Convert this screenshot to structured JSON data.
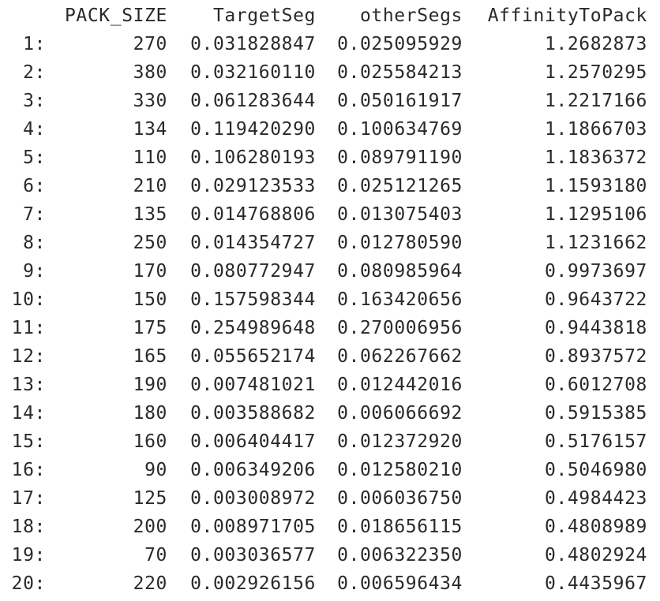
{
  "table": {
    "headers": {
      "index": "",
      "pack_size": "PACK_SIZE",
      "target_seg": "TargetSeg",
      "other_segs": "otherSegs",
      "affinity": "AffinityToPack"
    },
    "rows": [
      {
        "index": "1:",
        "pack_size": "270",
        "target_seg": "0.031828847",
        "other_segs": "0.025095929",
        "affinity": "1.2682873"
      },
      {
        "index": "2:",
        "pack_size": "380",
        "target_seg": "0.032160110",
        "other_segs": "0.025584213",
        "affinity": "1.2570295"
      },
      {
        "index": "3:",
        "pack_size": "330",
        "target_seg": "0.061283644",
        "other_segs": "0.050161917",
        "affinity": "1.2217166"
      },
      {
        "index": "4:",
        "pack_size": "134",
        "target_seg": "0.119420290",
        "other_segs": "0.100634769",
        "affinity": "1.1866703"
      },
      {
        "index": "5:",
        "pack_size": "110",
        "target_seg": "0.106280193",
        "other_segs": "0.089791190",
        "affinity": "1.1836372"
      },
      {
        "index": "6:",
        "pack_size": "210",
        "target_seg": "0.029123533",
        "other_segs": "0.025121265",
        "affinity": "1.1593180"
      },
      {
        "index": "7:",
        "pack_size": "135",
        "target_seg": "0.014768806",
        "other_segs": "0.013075403",
        "affinity": "1.1295106"
      },
      {
        "index": "8:",
        "pack_size": "250",
        "target_seg": "0.014354727",
        "other_segs": "0.012780590",
        "affinity": "1.1231662"
      },
      {
        "index": "9:",
        "pack_size": "170",
        "target_seg": "0.080772947",
        "other_segs": "0.080985964",
        "affinity": "0.9973697"
      },
      {
        "index": "10:",
        "pack_size": "150",
        "target_seg": "0.157598344",
        "other_segs": "0.163420656",
        "affinity": "0.9643722"
      },
      {
        "index": "11:",
        "pack_size": "175",
        "target_seg": "0.254989648",
        "other_segs": "0.270006956",
        "affinity": "0.9443818"
      },
      {
        "index": "12:",
        "pack_size": "165",
        "target_seg": "0.055652174",
        "other_segs": "0.062267662",
        "affinity": "0.8937572"
      },
      {
        "index": "13:",
        "pack_size": "190",
        "target_seg": "0.007481021",
        "other_segs": "0.012442016",
        "affinity": "0.6012708"
      },
      {
        "index": "14:",
        "pack_size": "180",
        "target_seg": "0.003588682",
        "other_segs": "0.006066692",
        "affinity": "0.5915385"
      },
      {
        "index": "15:",
        "pack_size": "160",
        "target_seg": "0.006404417",
        "other_segs": "0.012372920",
        "affinity": "0.5176157"
      },
      {
        "index": "16:",
        "pack_size": "90",
        "target_seg": "0.006349206",
        "other_segs": "0.012580210",
        "affinity": "0.5046980"
      },
      {
        "index": "17:",
        "pack_size": "125",
        "target_seg": "0.003008972",
        "other_segs": "0.006036750",
        "affinity": "0.4984423"
      },
      {
        "index": "18:",
        "pack_size": "200",
        "target_seg": "0.008971705",
        "other_segs": "0.018656115",
        "affinity": "0.4808989"
      },
      {
        "index": "19:",
        "pack_size": "70",
        "target_seg": "0.003036577",
        "other_segs": "0.006322350",
        "affinity": "0.4802924"
      },
      {
        "index": "20:",
        "pack_size": "220",
        "target_seg": "0.002926156",
        "other_segs": "0.006596434",
        "affinity": "0.4435967"
      }
    ]
  }
}
